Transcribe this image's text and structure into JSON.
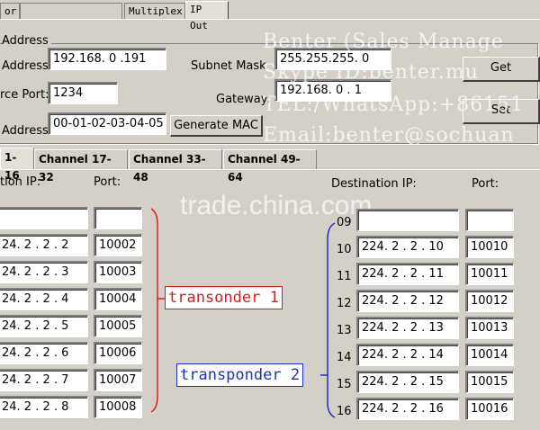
{
  "top_tabs": [
    {
      "label": "or",
      "active": false
    },
    {
      "label": "",
      "active": false
    },
    {
      "label": "Multiplex",
      "active": false
    },
    {
      "label": "IP Out",
      "active": true
    }
  ],
  "group": {
    "title": "Address"
  },
  "form": {
    "ip_label": "Address:",
    "ip_value": "192.168. 0 .191",
    "subnet_label": "Subnet Mask",
    "subnet_value": "255.255.255. 0",
    "port_label": "rce Port:",
    "port_value": "1234",
    "gateway_label": "Gateway:",
    "gateway_value": "192.168. 0 . 1",
    "mac_label": "Address:",
    "mac_value": "00-01-02-03-04-05",
    "generate_mac_label": "Generate MAC",
    "get_label": "Get",
    "set_label": "Set"
  },
  "channel_tabs": [
    {
      "label": "1-16",
      "active": true
    },
    {
      "label": "Channel 17-32",
      "active": false
    },
    {
      "label": "Channel 33-48",
      "active": false
    },
    {
      "label": "Channel 49-64",
      "active": false
    }
  ],
  "left_table": {
    "ip_header": "tion IP:",
    "port_header": "Port:",
    "rows": [
      {
        "ip": "",
        "port": ""
      },
      {
        "ip": "24. 2 . 2 . 2",
        "port": "10002"
      },
      {
        "ip": "24. 2 . 2 . 3",
        "port": "10003"
      },
      {
        "ip": "24. 2 . 2 . 4",
        "port": "10004"
      },
      {
        "ip": "24. 2 . 2 . 5",
        "port": "10005"
      },
      {
        "ip": "24. 2 . 2 . 6",
        "port": "10006"
      },
      {
        "ip": "24. 2 . 2 . 7",
        "port": "10007"
      },
      {
        "ip": "24. 2 . 2 . 8",
        "port": "10008"
      }
    ]
  },
  "right_table": {
    "ip_header": "Destination IP:",
    "port_header": "Port:",
    "rows": [
      {
        "num": "09",
        "ip": "",
        "port": ""
      },
      {
        "num": "10",
        "ip": "224. 2 . 2 . 10",
        "port": "10010"
      },
      {
        "num": "11",
        "ip": "224. 2 . 2 . 11",
        "port": "10011"
      },
      {
        "num": "12",
        "ip": "224. 2 . 2 . 12",
        "port": "10012"
      },
      {
        "num": "13",
        "ip": "224. 2 . 2 . 13",
        "port": "10013"
      },
      {
        "num": "14",
        "ip": "224. 2 . 2 . 14",
        "port": "10014"
      },
      {
        "num": "15",
        "ip": "224. 2 . 2 . 15",
        "port": "10015"
      },
      {
        "num": "16",
        "ip": "224. 2 . 2 . 16",
        "port": "10016"
      }
    ]
  },
  "annotations": {
    "transponder1": "transonder 1",
    "transponder2": "transponder 2",
    "color1": "#d42020",
    "color2": "#2030c0"
  },
  "watermarks": {
    "line1": "Benter (Sales Manage",
    "line2": "Skype ID:benter.mu",
    "line3": "TEL:/WhatsApp:+86151",
    "line4": "Email:benter@sochuan",
    "trade": "trade.china.com"
  }
}
